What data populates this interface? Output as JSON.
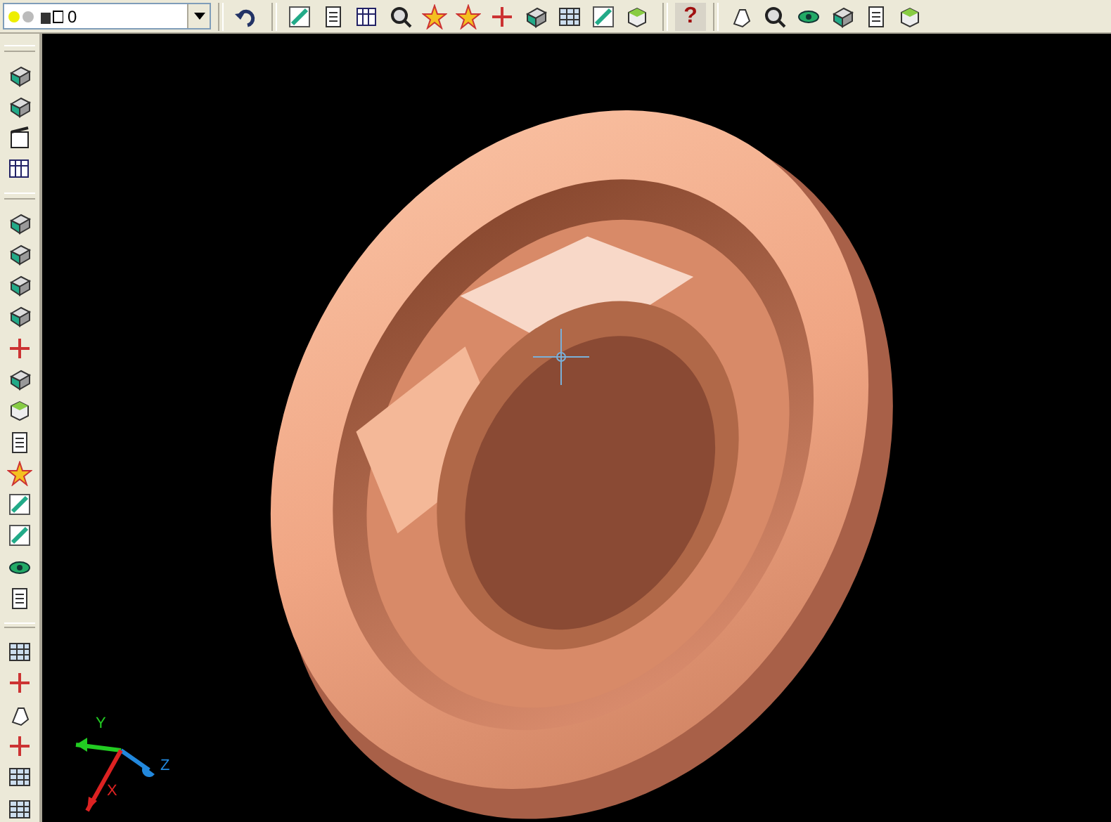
{
  "layer_control": {
    "value": "0"
  },
  "help_button": {
    "label": "?"
  },
  "ucs_icon": {
    "axes": [
      {
        "label": "Y",
        "color": "#22cc22"
      },
      {
        "label": "Z",
        "color": "#2288dd"
      },
      {
        "label": "X",
        "color": "#dd2222"
      }
    ]
  }
}
